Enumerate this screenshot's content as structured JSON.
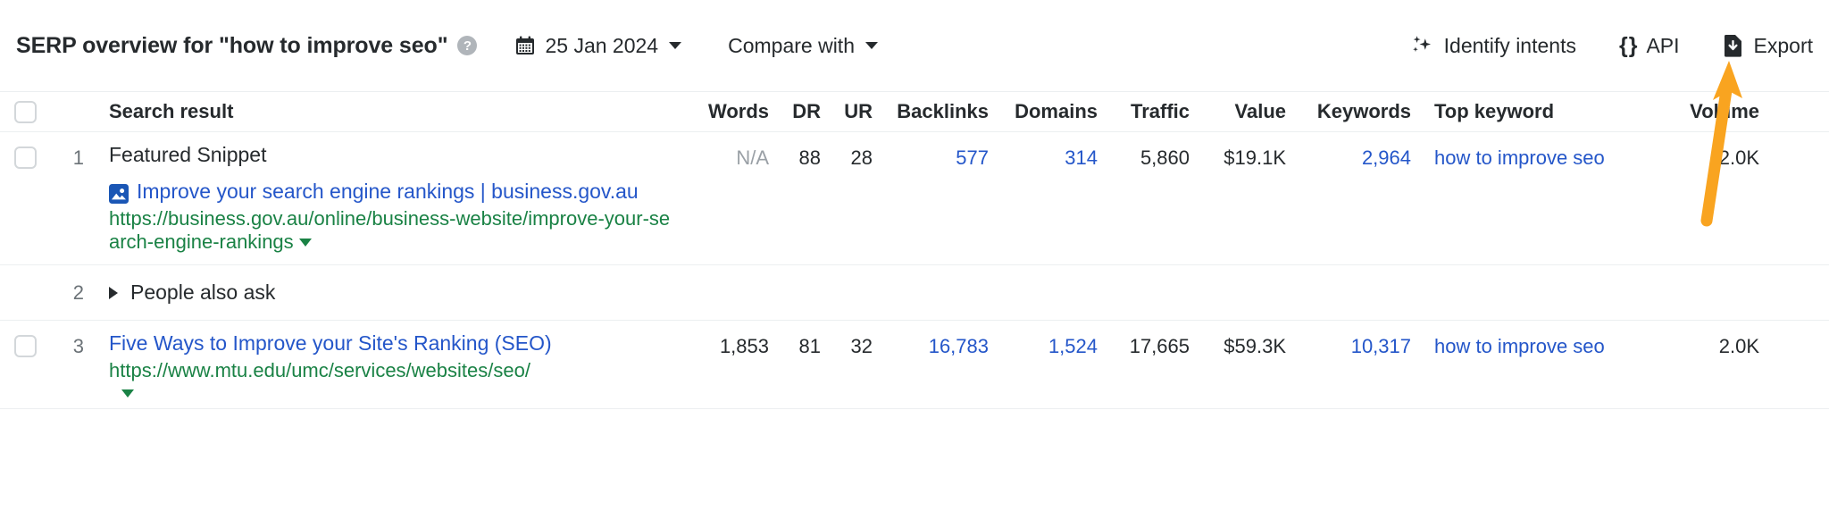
{
  "header": {
    "title": "SERP overview for \"how to improve seo\"",
    "help_icon_glyph": "?",
    "help_icon_name": "help-circle-icon",
    "date": "25 Jan 2024",
    "compare_label": "Compare with",
    "actions": [
      {
        "label": "Identify intents",
        "icon": "sparkle-icon"
      },
      {
        "label": "API",
        "icon": "curly-braces-icon"
      },
      {
        "label": "Export",
        "icon": "download-file-icon"
      }
    ]
  },
  "table": {
    "columns": {
      "search_result": "Search result",
      "words": "Words",
      "dr": "DR",
      "ur": "UR",
      "backlinks": "Backlinks",
      "domains": "Domains",
      "traffic": "Traffic",
      "value": "Value",
      "keywords": "Keywords",
      "top_keyword": "Top keyword",
      "volume": "Volume"
    },
    "rows": [
      {
        "position": "1",
        "type": "result",
        "serp_feature": "Featured Snippet",
        "title": "Improve your search engine rankings | business.gov.au",
        "url": "https://business.gov.au/online/business-website/improve-your-search-engine-rankings",
        "favicon": "image-placeholder-icon",
        "words": "N/A",
        "dr": "88",
        "ur": "28",
        "backlinks": "577",
        "domains": "314",
        "traffic": "5,860",
        "value": "$19.1K",
        "keywords": "2,964",
        "top_keyword": "how to improve seo",
        "volume": "2.0K"
      },
      {
        "position": "2",
        "type": "feature",
        "serp_feature": "People also ask"
      },
      {
        "position": "3",
        "type": "result",
        "title": "Five Ways to Improve your Site's Ranking (SEO)",
        "url": "https://www.mtu.edu/umc/services/websites/seo/",
        "words": "1,853",
        "dr": "81",
        "ur": "32",
        "backlinks": "16,783",
        "domains": "1,524",
        "traffic": "17,665",
        "value": "$59.3K",
        "keywords": "10,317",
        "top_keyword": "how to improve seo",
        "volume": "2.0K"
      }
    ]
  },
  "annotation": {
    "arrow_color": "#F9A420",
    "arrow_target": "export-button"
  },
  "colors": {
    "link_blue": "#2456c9",
    "url_green": "#1a8245",
    "text_dark": "#262a2d",
    "muted_gray": "#9aa0a6",
    "border": "#eceff1",
    "accent_orange": "#F9A420"
  }
}
